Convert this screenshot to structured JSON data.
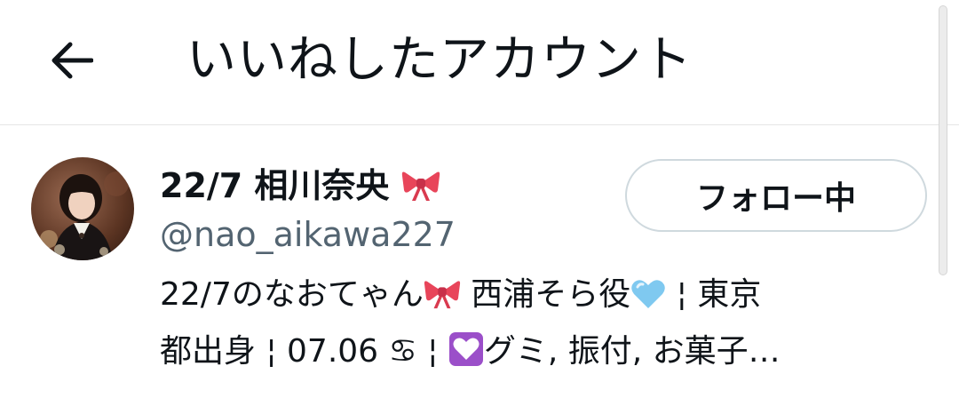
{
  "header": {
    "title": "いいねしたアカウント",
    "back_icon": "arrow-left-icon"
  },
  "user": {
    "display_name": "22/7 相川奈央",
    "name_emoji": "ribbon-icon",
    "handle": "@nao_aikawa227",
    "follow_label": "フォロー中",
    "bio_line1_a": "22/7のなおてゃん",
    "bio_line1_b": " 西浦そら役",
    "bio_line1_c": " ¦ 東京",
    "bio_line2_a": "都出身 ¦ 07.06 ",
    "bio_line2_b": "♋",
    "bio_line2_c": " ¦ ",
    "bio_line2_d": "グミ, 振付, お菓子…"
  },
  "colors": {
    "text": "#0f1419",
    "secondary": "#536471",
    "border": "#cfd9de",
    "ribbon": "#e8455a",
    "heart_light_blue": "#7fc9f0",
    "heart_tile_purple": "#9b4fc9"
  }
}
